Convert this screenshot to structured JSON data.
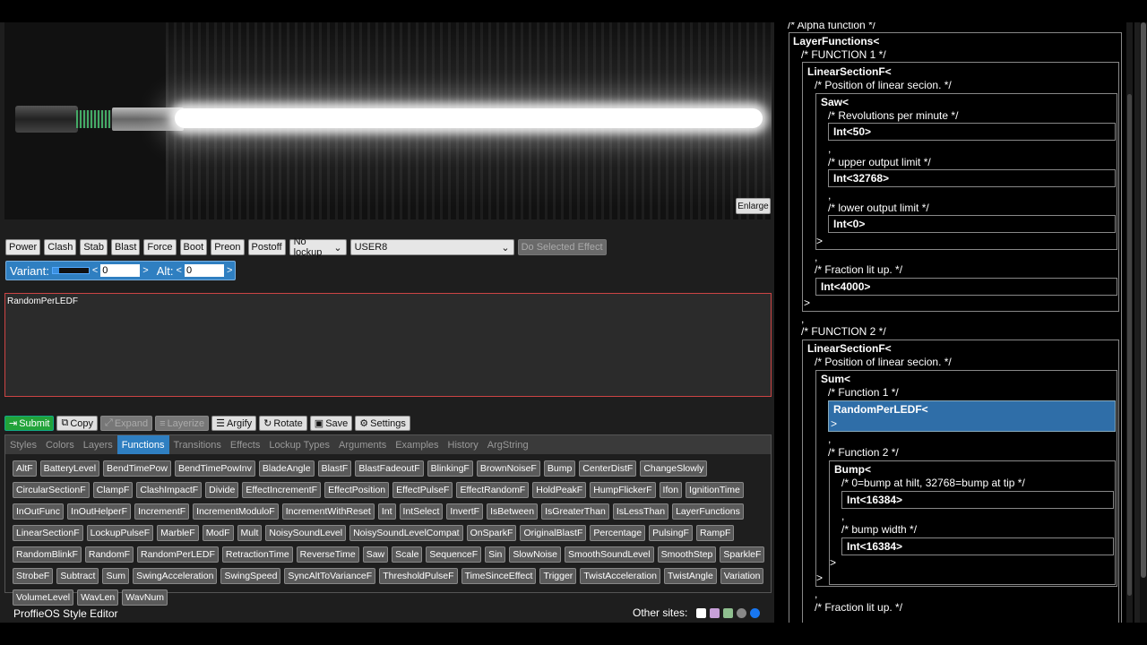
{
  "preview": {
    "enlarge_label": "Enlarge"
  },
  "effects": {
    "buttons": [
      "Power",
      "Clash",
      "Stab",
      "Blast",
      "Force",
      "Boot",
      "Preon",
      "Postoff"
    ],
    "lockup_select": "No lockup",
    "effect_select": "USER8",
    "do_selected_label": "Do Selected Effect"
  },
  "variant": {
    "label": "Variant:",
    "value": "0",
    "alt_label": "Alt:",
    "alt_value": "0",
    "left": "<",
    "right": ">"
  },
  "style_text": "RandomPerLEDF",
  "toolbar": {
    "submit": "Submit",
    "copy": "Copy",
    "expand": "Expand",
    "layerize": "Layerize",
    "argify": "Argify",
    "rotate": "Rotate",
    "save": "Save",
    "settings": "Settings"
  },
  "tabs": [
    "Styles",
    "Colors",
    "Layers",
    "Functions",
    "Transitions",
    "Effects",
    "Lockup Types",
    "Arguments",
    "Examples",
    "History",
    "ArgString"
  ],
  "active_tab": "Functions",
  "functions": [
    "AltF",
    "BatteryLevel",
    "BendTimePow",
    "BendTimePowInv",
    "BladeAngle",
    "BlastF",
    "BlastFadeoutF",
    "BlinkingF",
    "BrownNoiseF",
    "Bump",
    "CenterDistF",
    "ChangeSlowly",
    "CircularSectionF",
    "ClampF",
    "ClashImpactF",
    "Divide",
    "EffectIncrementF",
    "EffectPosition",
    "EffectPulseF",
    "EffectRandomF",
    "HoldPeakF",
    "HumpFlickerF",
    "Ifon",
    "IgnitionTime",
    "InOutFunc",
    "InOutHelperF",
    "IncrementF",
    "IncrementModuloF",
    "IncrementWithReset",
    "Int",
    "IntSelect",
    "InvertF",
    "IsBetween",
    "IsGreaterThan",
    "IsLessThan",
    "LayerFunctions",
    "LinearSectionF",
    "LockupPulseF",
    "MarbleF",
    "ModF",
    "Mult",
    "NoisySoundLevel",
    "NoisySoundLevelCompat",
    "OnSparkF",
    "OriginalBlastF",
    "Percentage",
    "PulsingF",
    "RampF",
    "RandomBlinkF",
    "RandomF",
    "RandomPerLEDF",
    "RetractionTime",
    "ReverseTime",
    "Saw",
    "Scale",
    "SequenceF",
    "Sin",
    "SlowNoise",
    "SmoothSoundLevel",
    "SmoothStep",
    "SparkleF",
    "StrobeF",
    "Subtract",
    "Sum",
    "SwingAcceleration",
    "SwingSpeed",
    "SyncAltToVarianceF",
    "ThresholdPulseF",
    "TimeSinceEffect",
    "Trigger",
    "TwistAcceleration",
    "TwistAngle",
    "Variation",
    "VolumeLevel",
    "WavLen",
    "WavNum"
  ],
  "footer": {
    "title": "ProffieOS Style Editor",
    "other_sites": "Other sites:"
  },
  "code": {
    "c_alpha": "/* Alpha function */",
    "layer_functions": "LayerFunctions<",
    "c_f1": "/* FUNCTION 1 */",
    "linear1": "LinearSectionF<",
    "c_pos1": "/* Position of linear secion. */",
    "saw": "Saw<",
    "c_rpm": "/* Revolutions per minute */",
    "int50": "Int<50>",
    "comma": ",",
    "c_upper": "/* upper output limit */",
    "int32768": "Int<32768>",
    "c_lower": "/* lower output limit */",
    "int0": "Int<0>",
    "gt": ">",
    "c_frac1": "/* Fraction lit up. */",
    "int4000": "Int<4000>",
    "c_f2": "/* FUNCTION 2 */",
    "linear2": "LinearSectionF<",
    "c_pos2": "/* Position of linear secion. */",
    "sum": "Sum<",
    "c_fn1": "/* Function 1 */",
    "random": "RandomPerLEDF<",
    "c_fn2": "/* Function 2 */",
    "bump": "Bump<",
    "c_bumpat": "/* 0=bump at hilt, 32768=bump at tip */",
    "int16384a": "Int<16384>",
    "c_width": "/* bump width */",
    "int16384b": "Int<16384>",
    "c_frac2": "/* Fraction lit up. */"
  }
}
